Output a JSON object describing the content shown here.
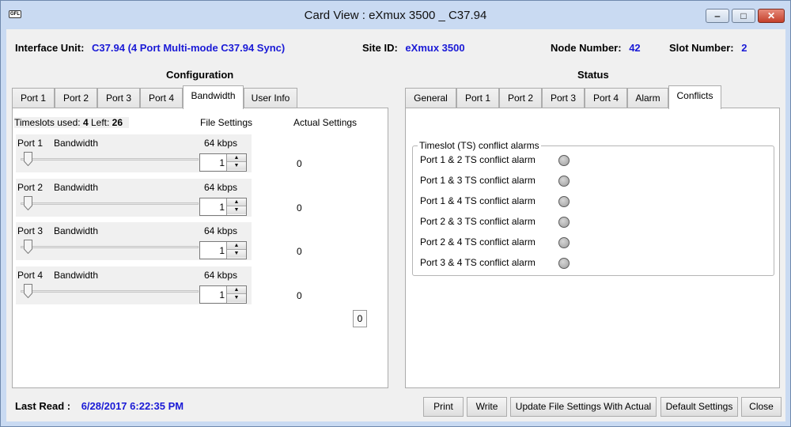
{
  "window": {
    "title": "Card View : eXmux 3500 _ C37.94",
    "app_icon_text": "GFL",
    "controls": {
      "minimize": "‒",
      "maximize": "□",
      "close": "✕"
    }
  },
  "header": {
    "interface_unit_label": "Interface Unit:",
    "interface_unit_value": "C37.94 (4 Port Multi-mode C37.94 Sync)",
    "site_id_label": "Site ID:",
    "site_id_value": "eXmux 3500",
    "node_number_label": "Node Number:",
    "node_number_value": "42",
    "slot_number_label": "Slot Number:",
    "slot_number_value": "2"
  },
  "configuration": {
    "title": "Configuration",
    "tabs": [
      "Port 1",
      "Port 2",
      "Port 3",
      "Port 4",
      "Bandwidth",
      "User Info"
    ],
    "active_tab": "Bandwidth",
    "timeslots_used_label": "Timeslots used:",
    "timeslots_used_value": "4",
    "left_label": "Left:",
    "left_value": "26",
    "file_settings_header": "File Settings",
    "actual_settings_header": "Actual Settings",
    "ports": [
      {
        "name": "Port 1",
        "bw_label": "Bandwidth",
        "rate": "64 kbps",
        "value": "1",
        "actual": "0",
        "slider_fraction": 0.0
      },
      {
        "name": "Port 2",
        "bw_label": "Bandwidth",
        "rate": "64 kbps",
        "value": "1",
        "actual": "0",
        "slider_fraction": 0.0
      },
      {
        "name": "Port 3",
        "bw_label": "Bandwidth",
        "rate": "64 kbps",
        "value": "1",
        "actual": "0",
        "slider_fraction": 0.0
      },
      {
        "name": "Port 4",
        "bw_label": "Bandwidth",
        "rate": "64 kbps",
        "value": "1",
        "actual": "0",
        "slider_fraction": 0.0
      }
    ],
    "total_box": "0"
  },
  "status": {
    "title": "Status",
    "tabs": [
      "General",
      "Port 1",
      "Port 2",
      "Port 3",
      "Port 4",
      "Alarm",
      "Conflicts"
    ],
    "active_tab": "Conflicts",
    "group_title": "Timeslot (TS) conflict alarms",
    "alarms": [
      "Port 1 & 2 TS conflict alarm",
      "Port 1 & 3 TS conflict alarm",
      "Port 1 & 4 TS conflict alarm",
      "Port 2 & 3 TS conflict alarm",
      "Port 2 & 4 TS conflict alarm",
      "Port 3 & 4 TS conflict alarm"
    ],
    "led_color": "#a0a0a0"
  },
  "footer": {
    "last_read_label": "Last Read :",
    "last_read_value": "6/28/2017 6:22:35 PM",
    "buttons": {
      "print": "Print",
      "write": "Write",
      "update": "Update File Settings With Actual",
      "default": "Default Settings",
      "close": "Close"
    }
  },
  "colors": {
    "value_blue": "#1a1ad6",
    "title_bar": "#c9daf2",
    "close_red": "#c5402b"
  }
}
